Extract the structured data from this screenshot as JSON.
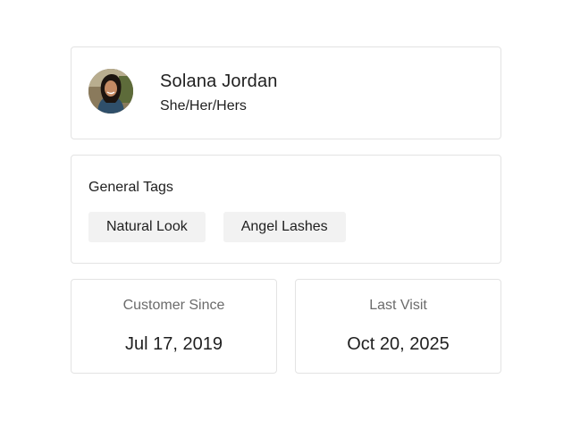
{
  "profile": {
    "name": "Solana Jordan",
    "pronouns": "She/Her/Hers"
  },
  "tags": {
    "title": "General Tags",
    "items": [
      "Natural Look",
      "Angel Lashes"
    ]
  },
  "stats": {
    "customer_since": {
      "label": "Customer Since",
      "value": "Jul 17, 2019"
    },
    "last_visit": {
      "label": "Last Visit",
      "value": "Oct 20, 2025"
    }
  }
}
